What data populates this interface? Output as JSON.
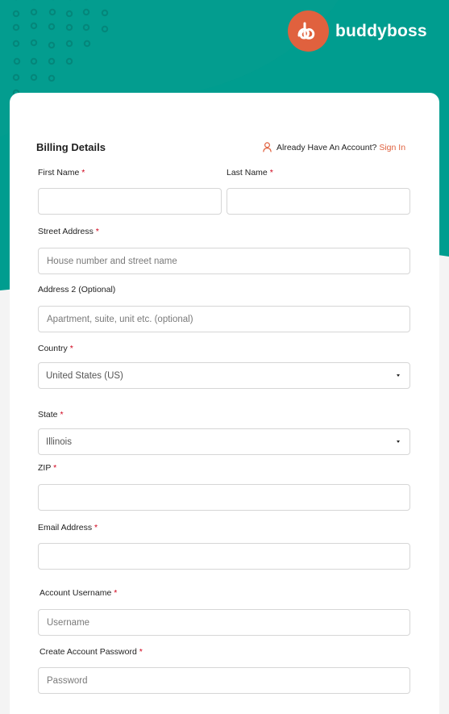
{
  "brand": {
    "name": "buddyboss",
    "colors": {
      "teal": "#009d8f",
      "orange": "#e0613e",
      "required": "#d0021b"
    }
  },
  "form": {
    "heading": "Billing Details",
    "login_prompt": "Already Have An Account?",
    "signin_label": "Sign In",
    "first_name": {
      "label": "First Name",
      "required_mark": "*",
      "value": ""
    },
    "last_name": {
      "label": "Last Name",
      "required_mark": "*",
      "value": ""
    },
    "street": {
      "label": "Street Address",
      "required_mark": "*",
      "placeholder": "House number and street name"
    },
    "address2": {
      "label": "Address 2 (Optional)",
      "placeholder": "Apartment, suite, unit etc. (optional)"
    },
    "country": {
      "label": "Country",
      "required_mark": "*",
      "value": "United States (US)"
    },
    "state": {
      "label": "State",
      "required_mark": "*",
      "value": "Illinois"
    },
    "zip": {
      "label": "ZIP",
      "required_mark": "*",
      "value": ""
    },
    "email": {
      "label": "Email Address",
      "required_mark": "*",
      "value": ""
    },
    "username": {
      "label": "Account Username",
      "required_mark": "*",
      "placeholder": "Username"
    },
    "password": {
      "label": "Create Account Password",
      "required_mark": "*",
      "placeholder": "Password"
    }
  },
  "icons": {
    "logo": "buddyboss-logo-icon",
    "user": "user-icon",
    "dropdown": "chevron-down-icon"
  }
}
